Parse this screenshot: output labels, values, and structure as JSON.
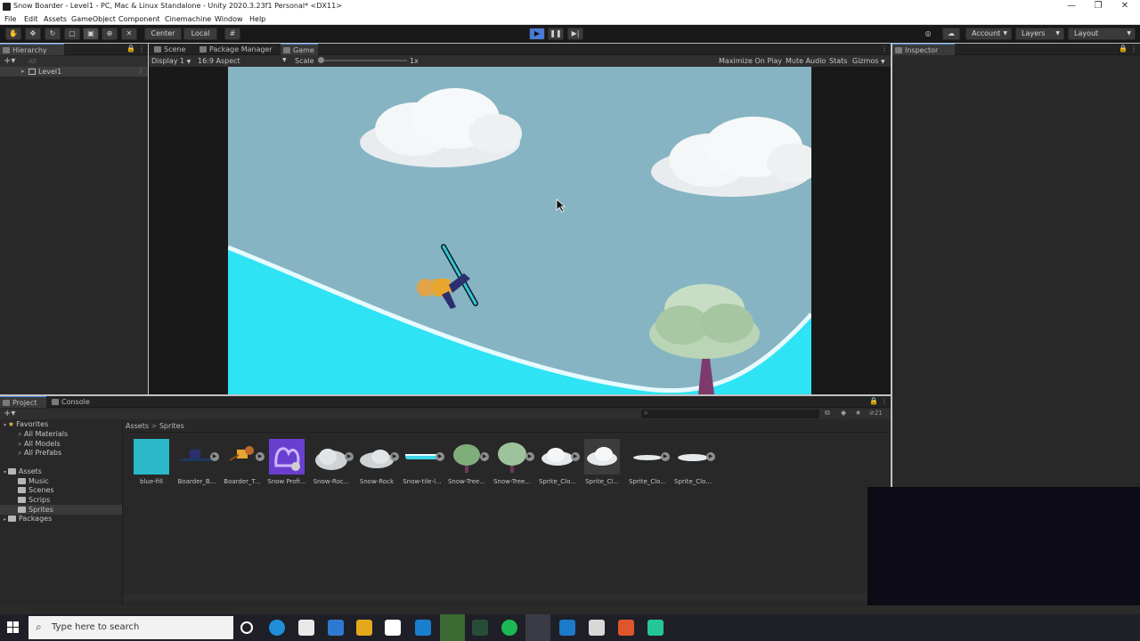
{
  "window": {
    "title": "Snow Boarder - Level1 - PC, Mac & Linux Standalone - Unity 2020.3.23f1 Personal* <DX11>",
    "controls": [
      "—",
      "❐",
      "✕"
    ]
  },
  "menu": [
    "File",
    "Edit",
    "Assets",
    "GameObject",
    "Component",
    "Cinemachine",
    "Window",
    "Help"
  ],
  "toolbar": {
    "pivot_center": "Center",
    "pivot_local": "Local",
    "account": "Account",
    "layers": "Layers",
    "layout": "Layout"
  },
  "hierarchy": {
    "tab": "Hierarchy",
    "search_placeholder": "All",
    "root_item": "Level1"
  },
  "scene_tabs": [
    {
      "label": "Scene"
    },
    {
      "label": "Package Manager"
    },
    {
      "label": "Game"
    }
  ],
  "game_view": {
    "display": "Display 1",
    "aspect": "16:9 Aspect",
    "scale_label": "Scale",
    "scale_value": "1x",
    "scale_fraction": 0.0,
    "options": [
      "Maximize On Play",
      "Mute Audio",
      "Stats",
      "Gizmos"
    ],
    "sky_color": "#86b4c3",
    "snow_color": "#2ee3f3"
  },
  "inspector": {
    "tab": "Inspector"
  },
  "project": {
    "tabs": [
      "Project",
      "Console"
    ],
    "hidden_count": "21",
    "breadcrumb": [
      "Assets",
      "Sprites"
    ],
    "tree": {
      "favorites": "Favorites",
      "favorite_items": [
        "All Materials",
        "All Models",
        "All Prefabs"
      ],
      "assets": "Assets",
      "asset_folders": [
        "Music",
        "Scenes",
        "Scrips",
        "Sprites"
      ],
      "packages": "Packages"
    },
    "assets": [
      "blue-fill",
      "Boarder_B...",
      "Boarder_T...",
      "Snow Profi...",
      "Snow-Roc...",
      "Snow-Rock",
      "Snow-tile-l...",
      "Snow-Tree...",
      "Snow-Tree...",
      "Sprite_Clo...",
      "Sprite_Cl...",
      "Sprite_Clo...",
      "Sprite_Clo..."
    ]
  },
  "taskbar": {
    "search_placeholder": "Type here to search"
  }
}
